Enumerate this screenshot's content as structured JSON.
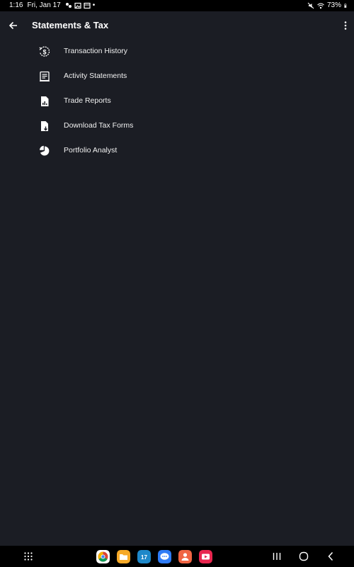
{
  "status_bar": {
    "time": "1:16",
    "date": "Fri, Jan 17",
    "battery": "73%",
    "dot": "•"
  },
  "app_bar": {
    "title": "Statements & Tax"
  },
  "menu": {
    "items": [
      {
        "label": "Transaction History",
        "icon": "dollar-history-icon"
      },
      {
        "label": "Activity Statements",
        "icon": "statement-document-icon"
      },
      {
        "label": "Trade Reports",
        "icon": "report-file-icon"
      },
      {
        "label": "Download Tax Forms",
        "icon": "download-file-icon"
      },
      {
        "label": "Portfolio Analyst",
        "icon": "pie-chart-icon"
      }
    ]
  },
  "dock": {
    "apps": [
      "chrome-app-icon",
      "files-app-icon",
      "calendar-app-icon",
      "messages-app-icon",
      "contacts-app-icon",
      "video-app-icon"
    ],
    "calendar_day": "17"
  },
  "colors": {
    "background": "#1b1d24",
    "bars": "#000000",
    "text": "#ffffff"
  }
}
